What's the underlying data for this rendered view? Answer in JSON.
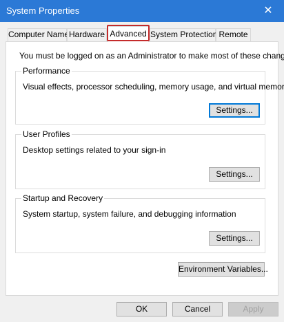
{
  "window": {
    "title": "System Properties"
  },
  "tabs": [
    {
      "label": "Computer Name"
    },
    {
      "label": "Hardware"
    },
    {
      "label": "Advanced"
    },
    {
      "label": "System Protection"
    },
    {
      "label": "Remote"
    }
  ],
  "active_tab": "Advanced",
  "notice": "You must be logged on as an Administrator to make most of these changes.",
  "groups": {
    "performance": {
      "title": "Performance",
      "description": "Visual effects, processor scheduling, memory usage, and virtual memory",
      "button": "Settings..."
    },
    "user_profiles": {
      "title": "User Profiles",
      "description": "Desktop settings related to your sign-in",
      "button": "Settings..."
    },
    "startup_recovery": {
      "title": "Startup and Recovery",
      "description": "System startup, system failure, and debugging information",
      "button": "Settings..."
    }
  },
  "environment_button": "Environment Variables...",
  "footer": {
    "ok": "OK",
    "cancel": "Cancel",
    "apply": "Apply"
  },
  "colors": {
    "titlebar": "#2b79d6",
    "highlight": "#c42b2b",
    "default_button_border": "#0078d7"
  }
}
